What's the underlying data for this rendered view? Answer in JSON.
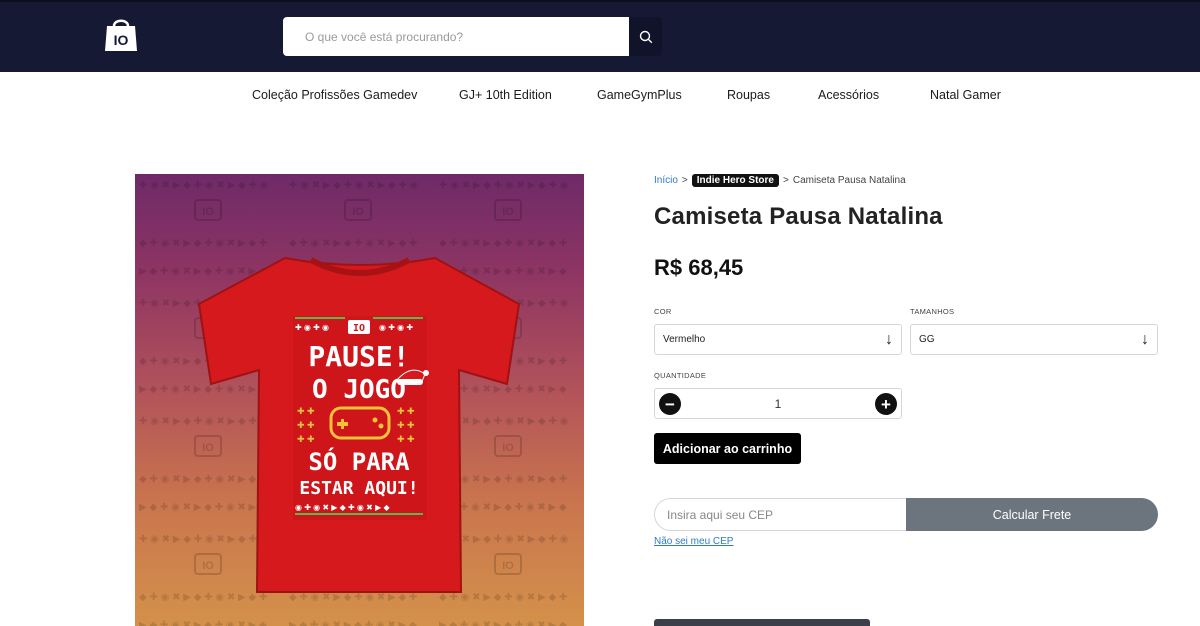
{
  "header": {
    "search_placeholder": "O que você está procurando?",
    "logo_icon": "bag-logo-icon",
    "search_icon": "search-icon"
  },
  "nav": {
    "items": [
      {
        "label": "Coleção Profissões Gamedev"
      },
      {
        "label": "GJ+ 10th Edition"
      },
      {
        "label": "GameGymPlus"
      },
      {
        "label": "Roupas"
      },
      {
        "label": "Acessórios"
      },
      {
        "label": "Natal Gamer"
      }
    ]
  },
  "breadcrumb": {
    "home": "Início",
    "sep1": ">",
    "store": "Indie Hero Store",
    "sep2": ">",
    "current": "Camiseta Pausa Natalina"
  },
  "product": {
    "title": "Camiseta Pausa Natalina",
    "price": "R$ 68,45",
    "shirt_text": {
      "badge": "IO",
      "line1": "PAUSE!",
      "line2": "O JOGO",
      "line3": "SÓ PARA",
      "line4": "ESTAR AQUI!"
    }
  },
  "options": {
    "color_label": "COR",
    "color_value": "Vermelho",
    "size_label": "TAMANHOS",
    "size_value": "GG",
    "arrow": "↓"
  },
  "quantity": {
    "label": "QUANTIDADE",
    "value": "1",
    "minus": "−",
    "plus": "+"
  },
  "cart": {
    "add_label": "Adicionar ao carrinho"
  },
  "shipping": {
    "cep_placeholder": "Insira aqui seu CEP",
    "calc_label": "Calcular Frete",
    "dont_know": "Não sei meu CEP"
  },
  "colors": {
    "header_bg": "#151934",
    "accent_link": "#2e7bc4",
    "shirt_red": "#d5191c",
    "calc_button": "#6c757d"
  }
}
